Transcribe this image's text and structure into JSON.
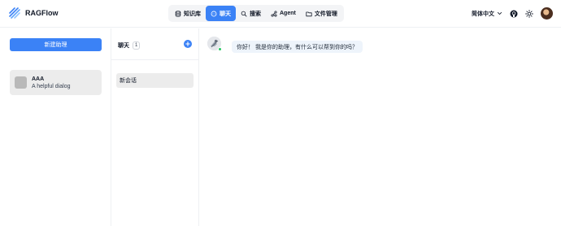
{
  "app": {
    "name": "RAGFlow"
  },
  "nav": {
    "items": [
      {
        "label": "知识库",
        "icon": "database-icon"
      },
      {
        "label": "聊天",
        "icon": "chat-icon",
        "active": true
      },
      {
        "label": "搜索",
        "icon": "search-icon"
      },
      {
        "label": "Agent",
        "icon": "agent-icon"
      },
      {
        "label": "文件管理",
        "icon": "folder-icon"
      }
    ]
  },
  "header": {
    "language": "简体中文"
  },
  "left": {
    "new_assistant_label": "新建助理",
    "assistants": [
      {
        "name": "AAA",
        "description": "A helpful dialog"
      }
    ]
  },
  "middle": {
    "title": "聊天",
    "count": "1",
    "conversations": [
      {
        "label": "新会话"
      }
    ]
  },
  "chat": {
    "messages": [
      {
        "role": "assistant",
        "text": "你好！ 我是你的助理，有什么可以帮到你的吗？"
      }
    ]
  },
  "colors": {
    "accent": "#3b82f6",
    "online": "#22c55e",
    "bubble": "#eef4fb",
    "selected": "#ececec"
  }
}
